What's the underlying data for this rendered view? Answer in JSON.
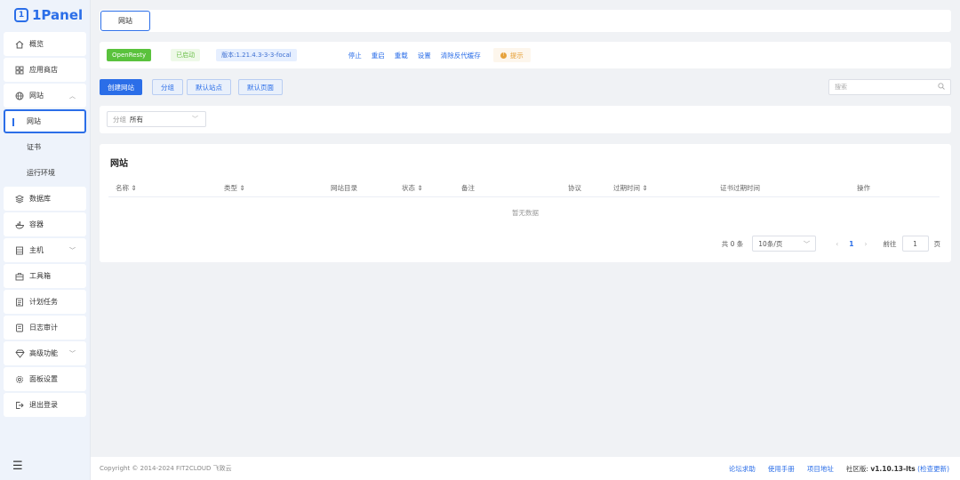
{
  "app": {
    "logo_text": "1Panel",
    "accent": "#2b6ee8"
  },
  "sidebar": {
    "items": [
      {
        "label": "概览",
        "icon": "home-icon"
      },
      {
        "label": "应用商店",
        "icon": "grid-icon"
      },
      {
        "label": "网站",
        "icon": "globe-icon"
      },
      {
        "label": "网站",
        "icon": ""
      },
      {
        "label": "证书",
        "icon": ""
      },
      {
        "label": "运行环境",
        "icon": ""
      },
      {
        "label": "数据库",
        "icon": "layers-icon"
      },
      {
        "label": "容器",
        "icon": "docker-icon"
      },
      {
        "label": "主机",
        "icon": "server-icon"
      },
      {
        "label": "工具箱",
        "icon": "toolbox-icon"
      },
      {
        "label": "计划任务",
        "icon": "list-icon"
      },
      {
        "label": "日志审计",
        "icon": "log-icon"
      },
      {
        "label": "高级功能",
        "icon": "diamond-icon"
      },
      {
        "label": "面板设置",
        "icon": "gear-icon"
      },
      {
        "label": "退出登录",
        "icon": "logout-icon"
      }
    ]
  },
  "tabs": [
    {
      "label": "网站"
    }
  ],
  "status": {
    "app_name": "OpenResty",
    "state": "已启动",
    "version": "版本:1.21.4.3-3-3-focal",
    "actions": [
      "停止",
      "重启",
      "重载",
      "设置",
      "清除反代缓存"
    ],
    "tip": "提示"
  },
  "toolbar": {
    "create": "创建网站",
    "group": "分组",
    "default_site": "默认站点",
    "default_page": "默认页面",
    "search_placeholder": "搜索"
  },
  "filter": {
    "label": "分组",
    "value": "所有"
  },
  "table": {
    "title": "网站",
    "columns": [
      "名称 ⇕",
      "类型 ⇕",
      "网站目录",
      "状态 ⇕",
      "备注",
      "协议",
      "过期时间 ⇕",
      "证书过期时间",
      "操作"
    ],
    "empty_text": "暂无数据"
  },
  "pagination": {
    "total": "共 0 条",
    "page_size": "10条/页",
    "current": "1",
    "goto_label": "前往",
    "goto_value": "1",
    "page_unit": "页"
  },
  "footer": {
    "copyright": "Copyright © 2014-2024 FIT2CLOUD 飞致云",
    "links": [
      "论坛求助",
      "使用手册",
      "项目地址"
    ],
    "edition_label": "社区版:",
    "version": "v1.10.13-lts",
    "check_update": "(检查更新)"
  }
}
